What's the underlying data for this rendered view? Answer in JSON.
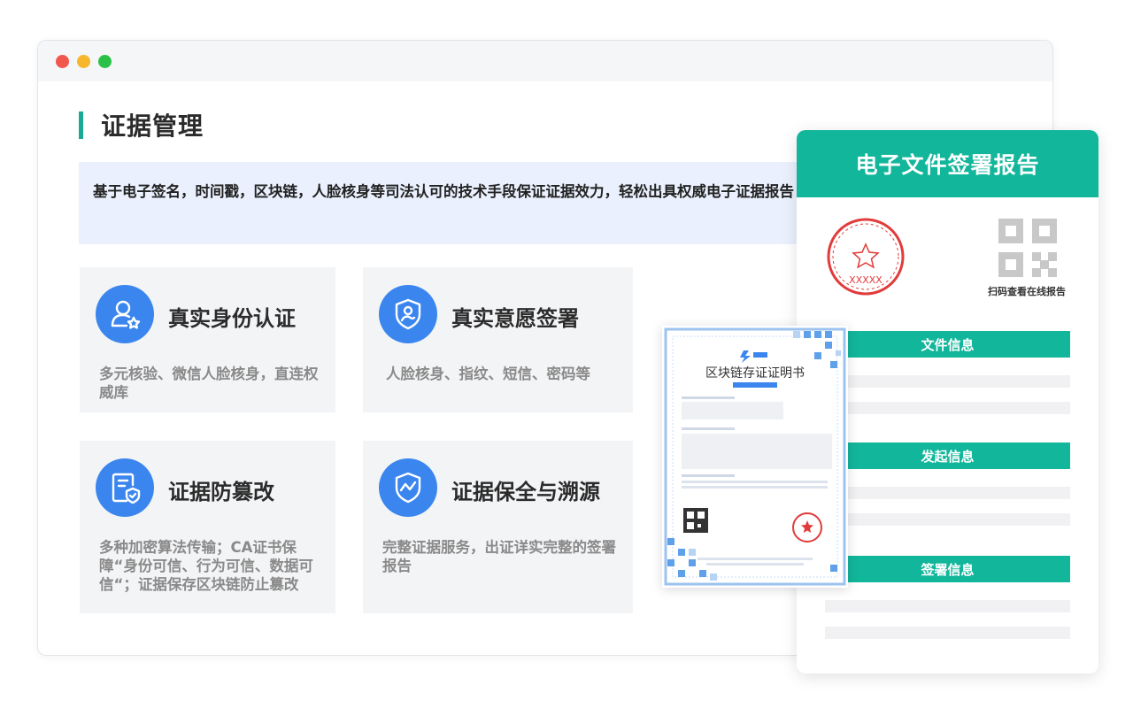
{
  "window": {
    "controls": [
      "close",
      "minimize",
      "maximize"
    ]
  },
  "page": {
    "title": "证据管理",
    "description": "基于电子签名，时间戳，区块链，人脸核身等司法认可的技术手段保证证据效力，轻松出具权威电子证据报告"
  },
  "features": [
    {
      "icon": "user-star-icon",
      "title": "真实身份认证",
      "text": "多元核验、微信人脸核身，直连权威库"
    },
    {
      "icon": "shield-signature-icon",
      "title": "真实意愿签署",
      "text": "人脸核身、指纹、短信、密码等"
    },
    {
      "icon": "document-shield-icon",
      "title": "证据防篡改",
      "text": "多种加密算法传输；CA证书保障“身份可信、行为可信、数据可信“；证据保存区块链防止篡改"
    },
    {
      "icon": "shield-trend-icon",
      "title": "证据保全与溯源",
      "text": "完整证据服务，出证详实完整的签署报告"
    }
  ],
  "report": {
    "title": "电子文件签署报告",
    "stamp_text": "XXXXX",
    "qr_caption": "扫码查看在线报告",
    "sections": [
      "文件信息",
      "发起信息",
      "签署信息"
    ]
  },
  "certificate": {
    "title": "区块链存证证明书"
  },
  "colors": {
    "accent_teal": "#12b69b",
    "icon_blue": "#3b86ee",
    "desc_bg": "#eaf0fd",
    "stamp_red": "#e23b3b"
  }
}
